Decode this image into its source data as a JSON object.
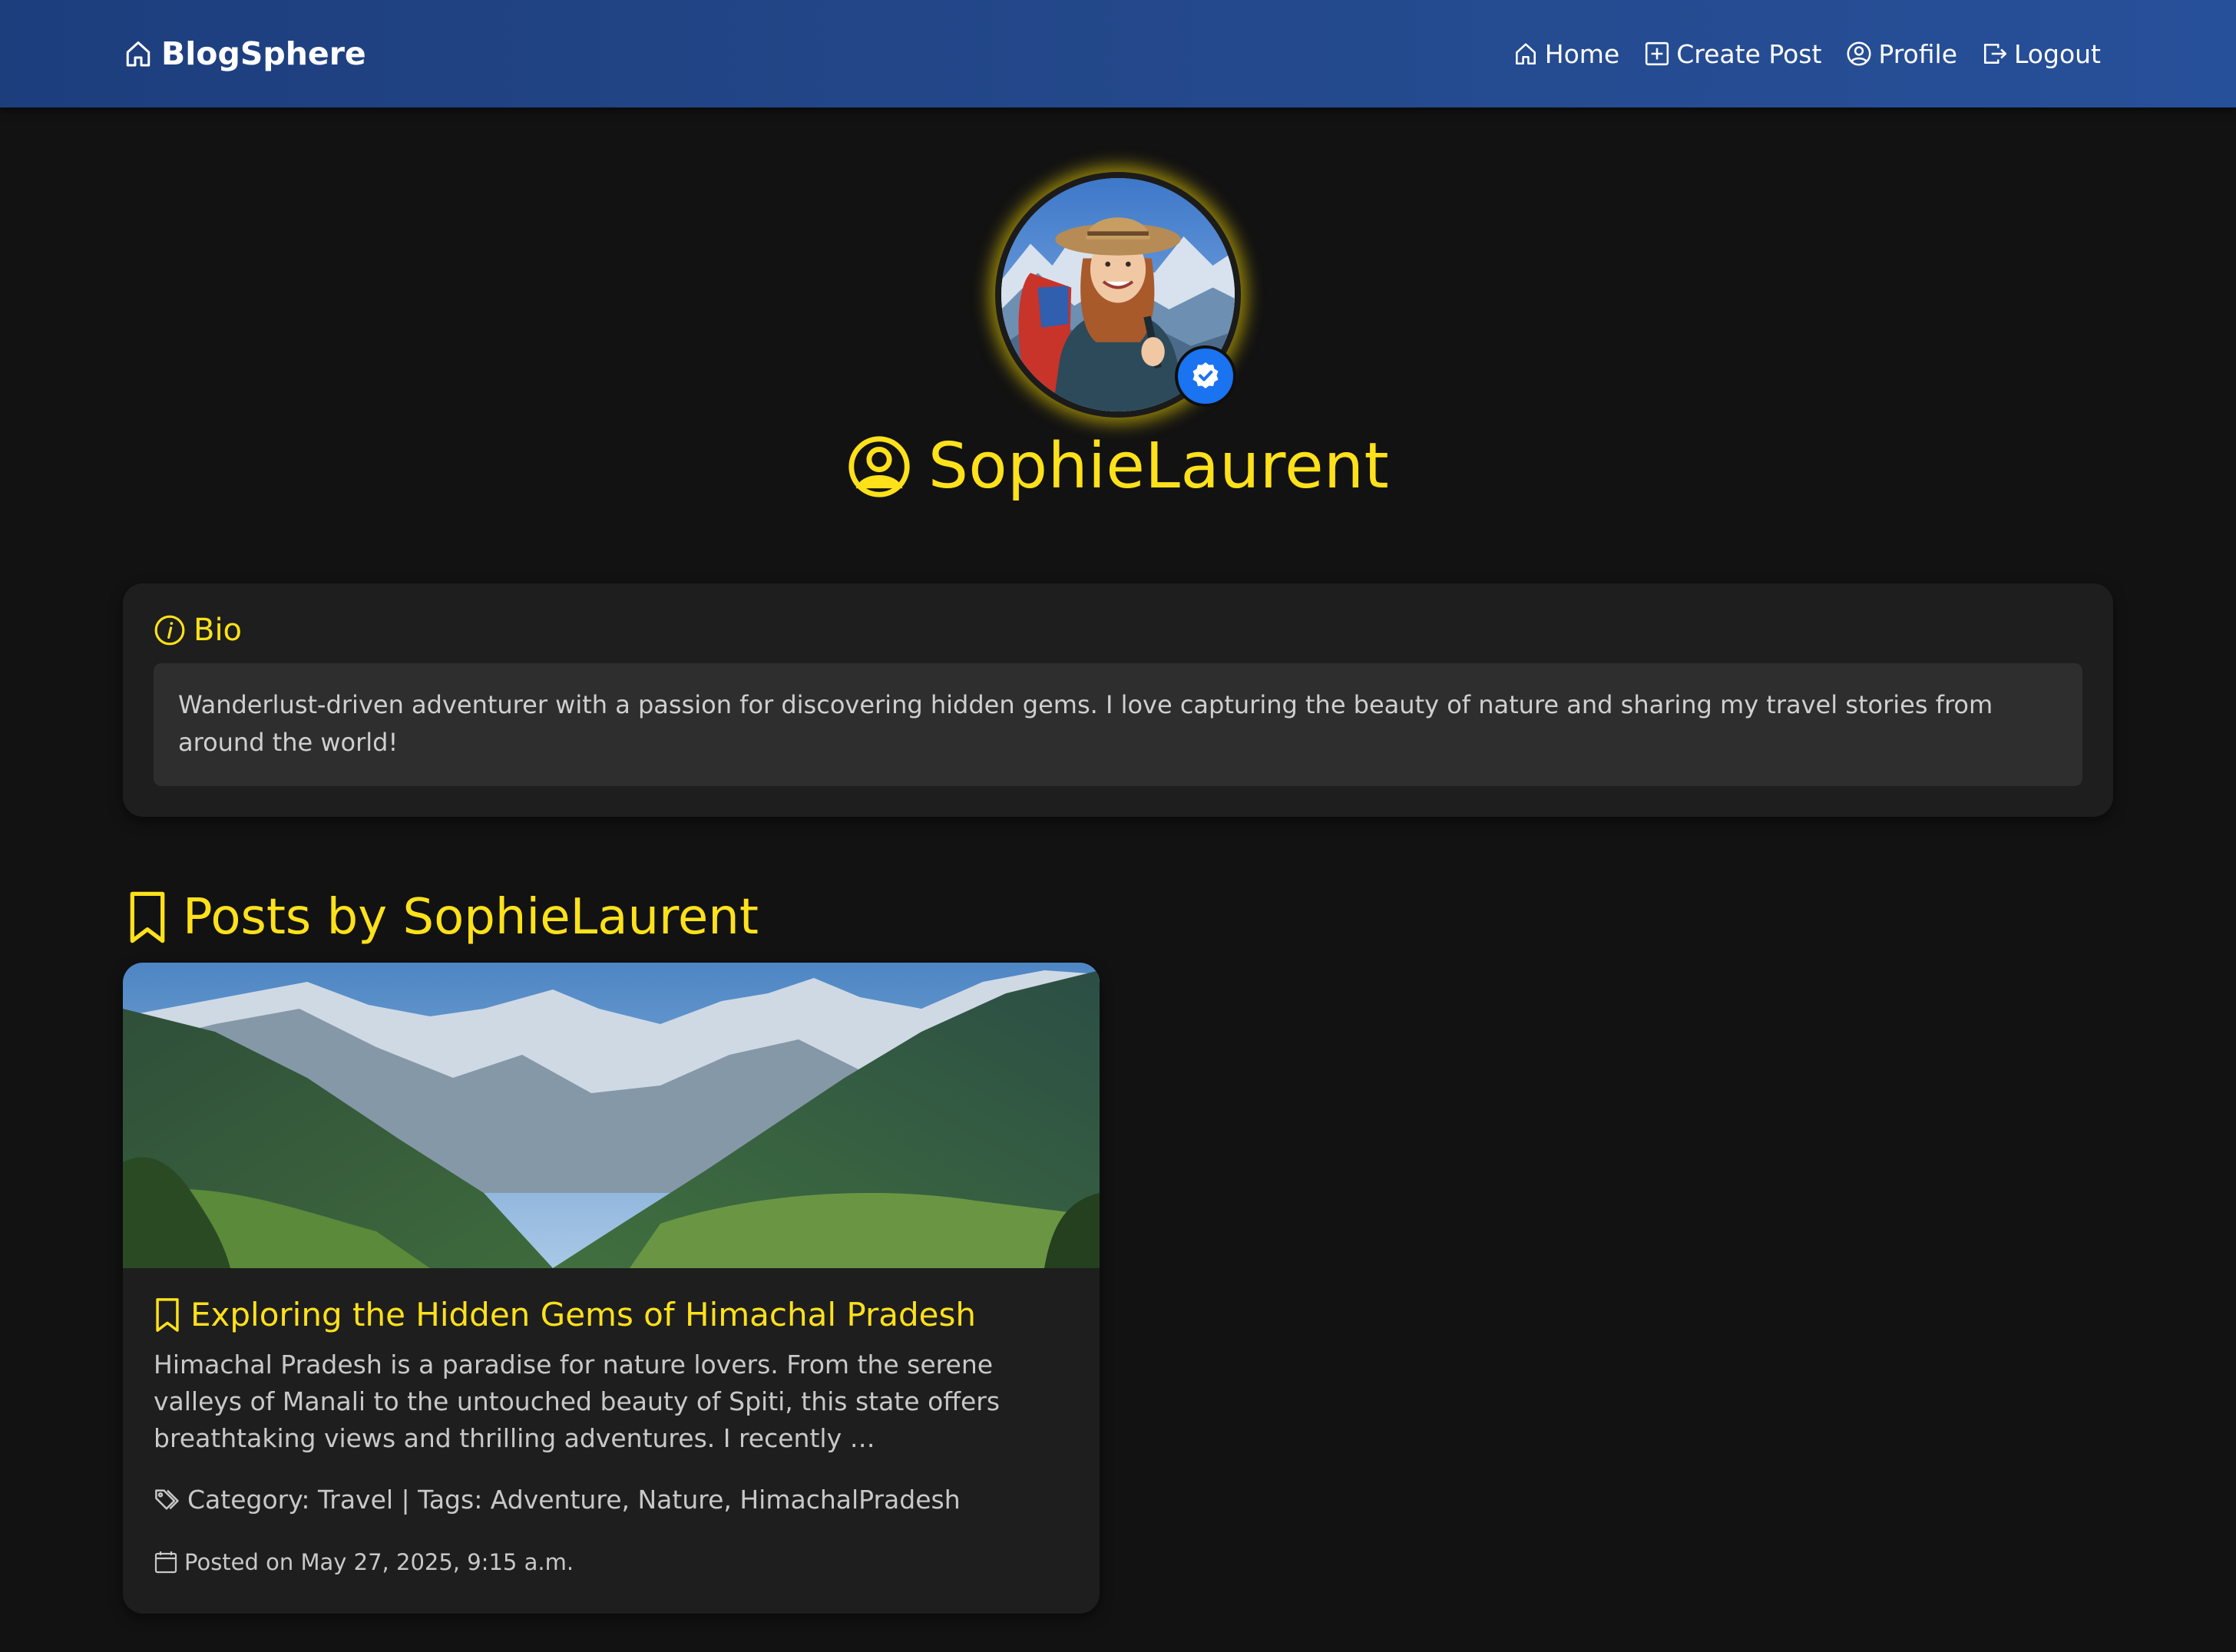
{
  "navbar": {
    "brand": "BlogSphere",
    "links": [
      {
        "label": "Home",
        "icon": "house-icon"
      },
      {
        "label": "Create Post",
        "icon": "plus-square-icon"
      },
      {
        "label": "Profile",
        "icon": "person-circle-icon"
      },
      {
        "label": "Logout",
        "icon": "box-arrow-right-icon"
      }
    ]
  },
  "profile": {
    "username": "SophieLaurent",
    "verified": true,
    "colors": {
      "accent": "#ffe11a",
      "badge": "#1a73f0",
      "navbar": "#24498c",
      "background": "#121212",
      "card": "#1e1e1e"
    }
  },
  "bio": {
    "heading": "Bio",
    "text": "Wanderlust-driven adventurer with a passion for discovering hidden gems. I love capturing the beauty of nature and sharing my travel stories from around the world!"
  },
  "posts": {
    "heading": "Posts by SophieLaurent",
    "items": [
      {
        "title": "Exploring the Hidden Gems of Himachal Pradesh",
        "excerpt": "Himachal Pradesh is a paradise for nature lovers. From the serene valleys of Manali to the untouched beauty of Spiti, this state offers breathtaking views and thrilling adventures. I recently …",
        "meta": "Category: Travel | Tags: Adventure, Nature, HimachalPradesh",
        "date": "Posted on May 27, 2025, 9:15 a.m."
      }
    ]
  }
}
